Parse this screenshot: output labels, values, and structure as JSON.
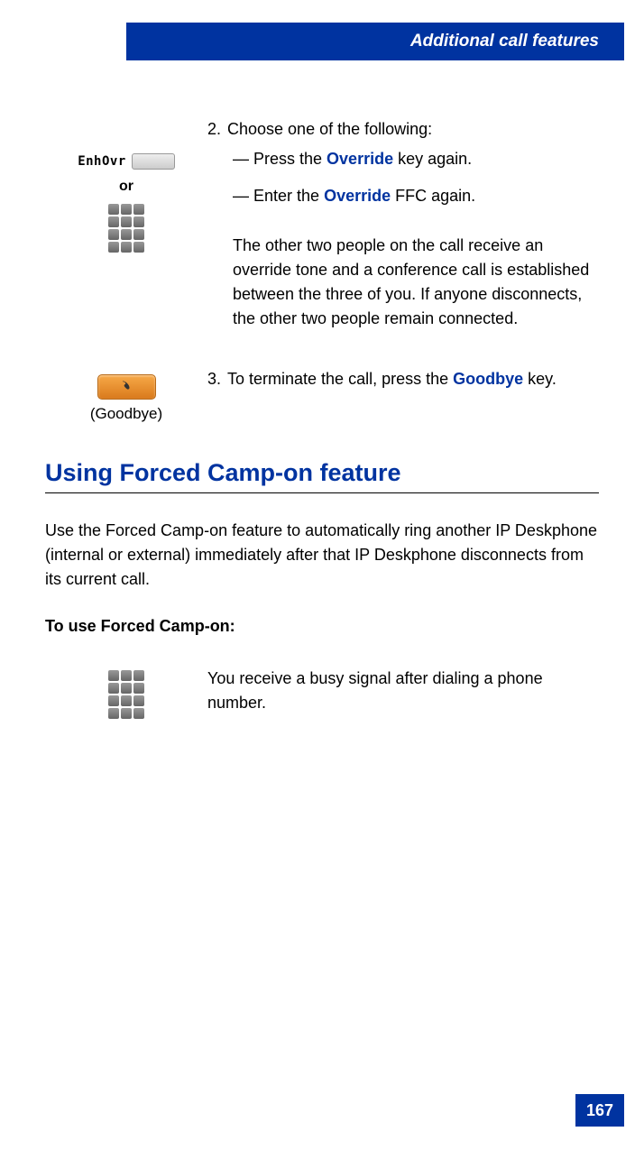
{
  "header": {
    "title": "Additional call features"
  },
  "step2": {
    "num": "2.",
    "lead": "Choose one of the following:",
    "opt1_prefix": "—   Press the ",
    "opt1_bold": "Override",
    "opt1_suffix": " key again.",
    "opt2_prefix": "—   Enter the ",
    "opt2_bold": "Override",
    "opt2_suffix": " FFC again.",
    "para": "The other two people on the call receive an override tone and a conference call is established between the three of you. If anyone disconnects, the other two people remain connected.",
    "left_label": "EnhOvr",
    "or": "or"
  },
  "step3": {
    "num": "3.",
    "prefix": "To terminate the call, press the ",
    "bold": "Goodbye",
    "suffix": " key.",
    "label": "(Goodbye)"
  },
  "section": {
    "heading": "Using Forced Camp-on feature",
    "intro": "Use the Forced Camp-on feature to automatically ring another IP Deskphone (internal or external) immediately after that IP Deskphone disconnects from its current call.",
    "subhead": "To use Forced Camp-on:",
    "busy": "You receive a busy signal after dialing a phone number."
  },
  "page_number": "167"
}
